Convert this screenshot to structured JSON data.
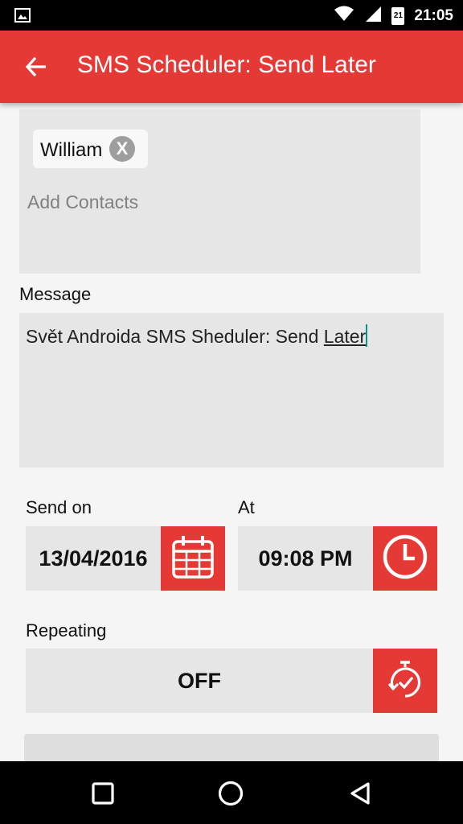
{
  "status_bar": {
    "time": "21:05",
    "calendar_day": "21"
  },
  "app_bar": {
    "title": "SMS Scheduler: Send Later"
  },
  "contacts": {
    "chip_name": "William",
    "chip_close": "X",
    "add_placeholder": "Add Contacts"
  },
  "message": {
    "label": "Message",
    "text_main": "Svět Androida SMS Sheduler: Send ",
    "text_underlined": "Later"
  },
  "schedule": {
    "send_on_label": "Send on",
    "date_value": "13/04/2016",
    "at_label": "At",
    "time_value": "09:08 PM"
  },
  "repeating": {
    "label": "Repeating",
    "value": "OFF"
  },
  "colors": {
    "accent": "#e53935",
    "cursor": "#009688",
    "field_bg": "#e6e6e6"
  }
}
